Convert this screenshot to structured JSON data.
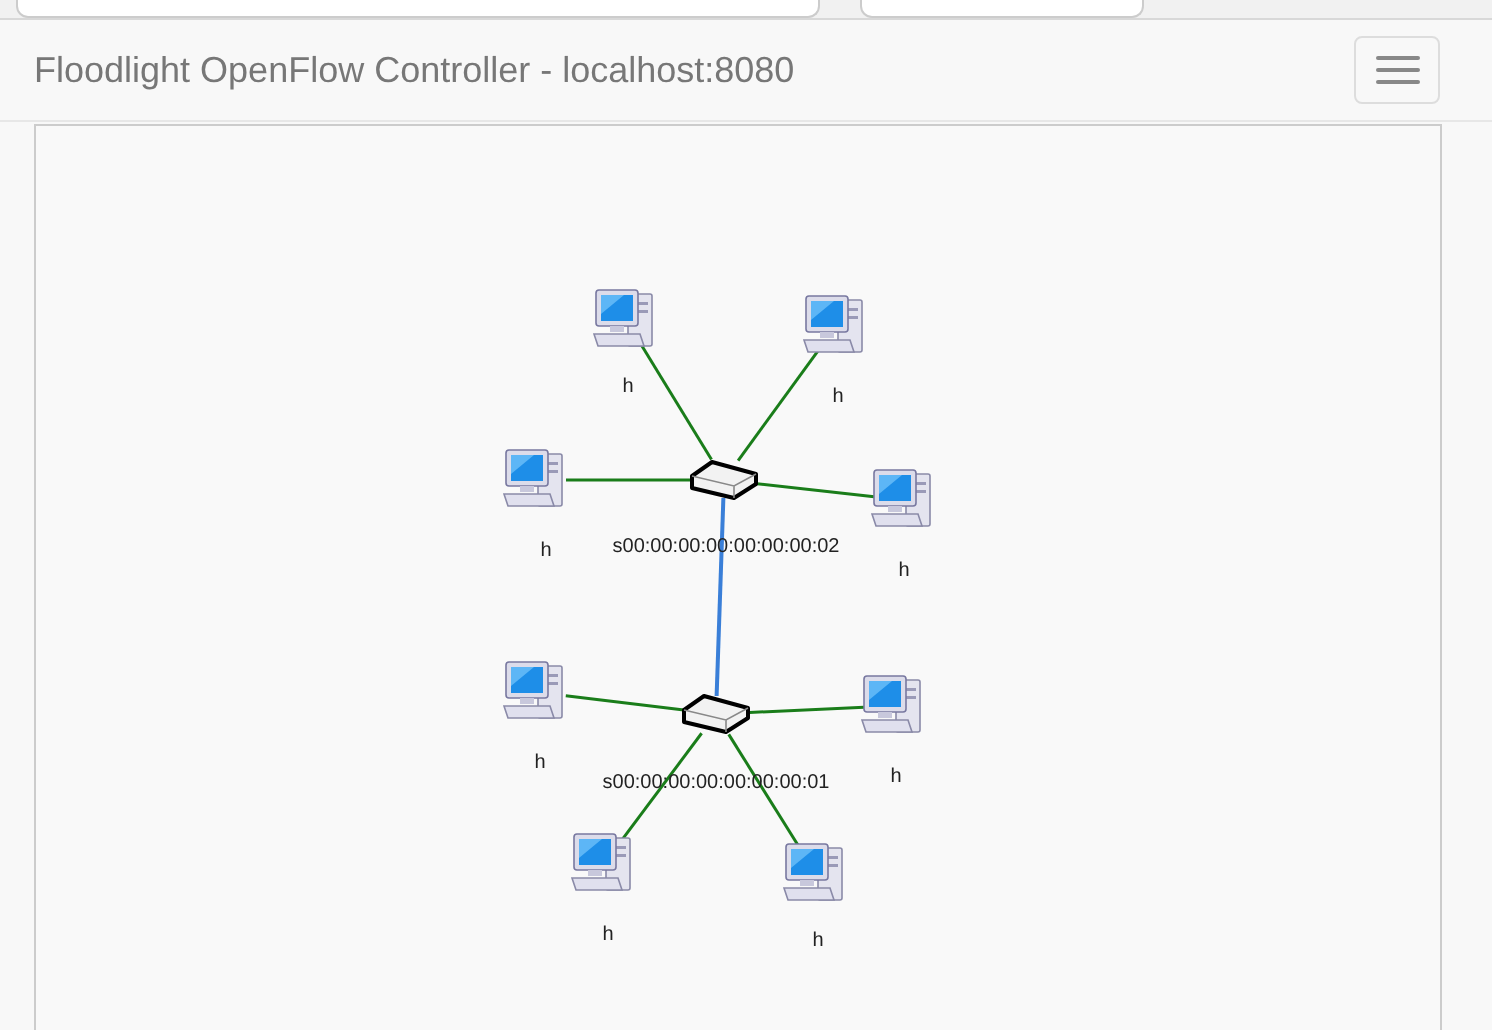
{
  "navbar": {
    "title": "Floodlight OpenFlow Controller - localhost:8080"
  },
  "topology": {
    "switches": [
      {
        "label": "s00:00:00:00:00:00:00:02",
        "hosts": [
          {
            "label": "h"
          },
          {
            "label": "h"
          },
          {
            "label": "h"
          },
          {
            "label": "h"
          }
        ]
      },
      {
        "label": "s00:00:00:00:00:00:00:01",
        "hosts": [
          {
            "label": "h"
          },
          {
            "label": "h"
          },
          {
            "label": "h"
          },
          {
            "label": "h"
          }
        ]
      }
    ]
  }
}
